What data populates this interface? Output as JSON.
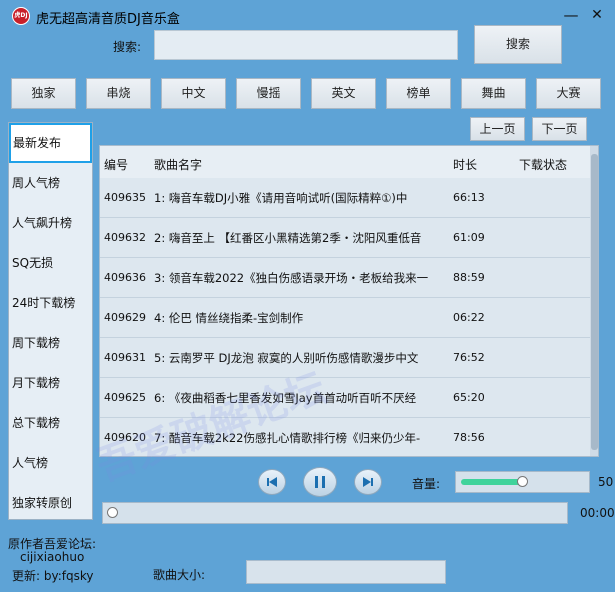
{
  "window": {
    "title": "虎无超高清音质DJ音乐盒",
    "icon": "app-logo-icon",
    "icon_text": "虎DJ",
    "minimize_glyph": "—",
    "close_glyph": "✕"
  },
  "search": {
    "label": "搜索:",
    "input_value": "",
    "button_label": "搜索"
  },
  "categories": [
    "独家",
    "串烧",
    "中文",
    "慢摇",
    "英文",
    "榜单",
    "舞曲",
    "大赛"
  ],
  "paging": {
    "prev_label": "上一页",
    "next_label": "下一页"
  },
  "sidebar": {
    "items": [
      "最新发布",
      "周人气榜",
      "人气飙升榜",
      "SQ无损",
      "24时下载榜",
      "周下载榜",
      "月下载榜",
      "总下载榜",
      "人气榜",
      "独家转原创"
    ],
    "active_index": 0
  },
  "table": {
    "headers": {
      "id": "编号",
      "title": "歌曲名字",
      "duration": "时长",
      "status": "下载状态"
    },
    "rows": [
      {
        "id": "409635",
        "title": "1: 嗨音车载DJ小雅《请用音响试听(国际精粹①)中",
        "duration": "66:13",
        "status": ""
      },
      {
        "id": "409632",
        "title": "2: 嗨音至上 【红番区小黑精选第2季・沈阳风重低音",
        "duration": "61:09",
        "status": ""
      },
      {
        "id": "409636",
        "title": "3: 领音车载2022《独白伤感语录开场・老板给我来一",
        "duration": "88:59",
        "status": ""
      },
      {
        "id": "409629",
        "title": "4: 伦巴    情丝绕指柔-宝剑制作",
        "duration": "06:22",
        "status": ""
      },
      {
        "id": "409631",
        "title": "5: 云南罗平 DJ龙泡 寂寞的人别听伤感情歌漫步中文",
        "duration": "76:52",
        "status": ""
      },
      {
        "id": "409625",
        "title": "6: 《夜曲稻香七里香发如雪Jay首首动听百听不厌经",
        "duration": "65:20",
        "status": ""
      },
      {
        "id": "409620",
        "title": "7: 酷音车载2k22伤感扎心情歌排行榜《归来仍少年-",
        "duration": "78:56",
        "status": ""
      }
    ]
  },
  "player": {
    "prev_icon": "skip-previous-icon",
    "pause_icon": "pause-icon",
    "next_icon": "skip-next-icon",
    "volume_label": "音量:",
    "volume_value": "50",
    "volume_fraction": 0.5,
    "progress_fraction": 0,
    "time": "00:00"
  },
  "footer": {
    "author_label": "原作者吾爱论坛:",
    "author_name": "cijixiaohuo",
    "update_label": "更新: by:fqsky",
    "size_label": "歌曲大小:",
    "size_value": ""
  },
  "watermark": "吾爱破解论坛",
  "colors": {
    "background": "#5ea3d6",
    "active_border": "#1ea0e8",
    "volume_fill": "#3fd39b"
  }
}
